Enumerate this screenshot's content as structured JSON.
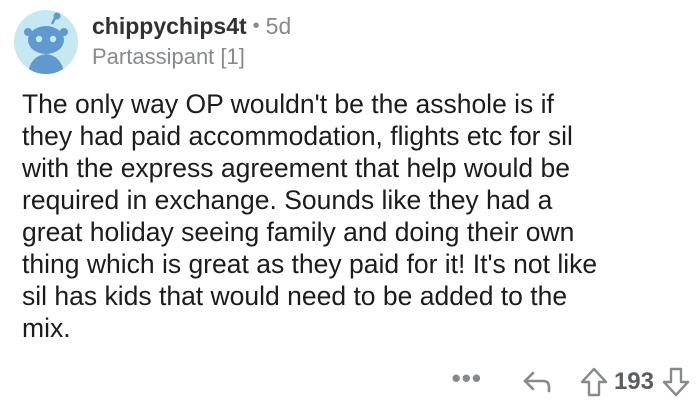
{
  "comment": {
    "author": "chippychips4t",
    "separator": "•",
    "age": "5d",
    "flair": "Partassipant [1]",
    "avatar_icon": "default-reddit-avatar-icon",
    "avatar_bg": "#c6e8f0",
    "text": "The only way OP wouldn't be the asshole is if\nthey  had paid accommodation, flights etc for sil\nwith the express agreement that help would be\nrequired in exchange. Sounds like they had a\ngreat holiday seeing family and doing their own\nthing which is great as they paid for it! It's not like\nsil has kids that would need to be added to the\nmix."
  },
  "actions": {
    "more_label": "•••",
    "reply_icon": "reply-arrow-icon",
    "upvote_icon": "upvote-arrow-icon",
    "score": "193",
    "downvote_icon": "downvote-arrow-icon"
  }
}
